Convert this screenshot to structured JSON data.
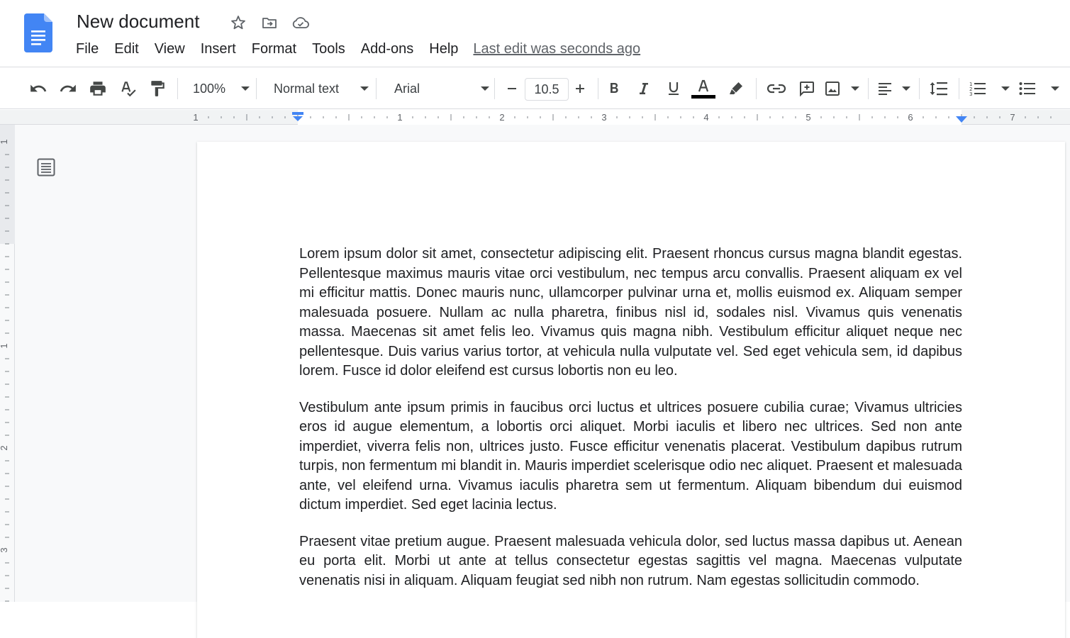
{
  "app": {
    "doc_title": "New document",
    "last_edit": "Last edit was seconds ago"
  },
  "menu": [
    "File",
    "Edit",
    "View",
    "Insert",
    "Format",
    "Tools",
    "Add-ons",
    "Help"
  ],
  "toolbar": {
    "zoom": "100%",
    "style": "Normal text",
    "font": "Arial",
    "font_size": "10.5"
  },
  "ruler": {
    "h_labels": [
      "1",
      "1",
      "2",
      "3",
      "4",
      "5",
      "6",
      "7"
    ],
    "v_labels": [
      "1",
      "1",
      "2",
      "3"
    ]
  },
  "document": {
    "paragraphs": [
      "Lorem ipsum dolor sit amet, consectetur adipiscing elit. Praesent rhoncus cursus magna blandit egestas. Pellentesque maximus mauris vitae orci vestibulum, nec tempus arcu convallis. Praesent aliquam ex vel mi efficitur mattis. Donec mauris nunc, ullamcorper pulvinar urna et, mollis euismod ex. Aliquam semper malesuada posuere. Nullam ac nulla pharetra, finibus nisl id, sodales nisl. Vivamus quis venenatis massa. Maecenas sit amet felis leo. Vivamus quis magna nibh. Vestibulum efficitur aliquet neque nec pellentesque. Duis varius varius tortor, at vehicula nulla vulputate vel. Sed eget vehicula sem, id dapibus lorem. Fusce id dolor eleifend est cursus lobortis non eu leo.",
      "Vestibulum ante ipsum primis in faucibus orci luctus et ultrices posuere cubilia curae; Vivamus ultricies eros id augue elementum, a lobortis orci aliquet. Morbi iaculis et libero nec ultrices. Sed non ante imperdiet, viverra felis non, ultrices justo. Fusce efficitur venenatis placerat. Vestibulum dapibus rutrum turpis, non fermentum mi blandit in. Mauris imperdiet scelerisque odio nec aliquet. Praesent et malesuada ante, vel eleifend urna. Vivamus iaculis pharetra sem ut fermentum. Aliquam bibendum dui euismod dictum imperdiet. Sed eget lacinia lectus.",
      "Praesent vitae pretium augue. Praesent malesuada vehicula dolor, sed luctus massa dapibus ut. Aenean eu porta elit. Morbi ut ante at tellus consectetur egestas sagittis vel magna. Maecenas vulputate venenatis nisi in aliquam. Aliquam feugiat sed nibh non rutrum. Nam egestas sollicitudin commodo."
    ]
  },
  "colors": {
    "docs_blue": "#4285f4",
    "text_color_underline": "#000000",
    "ruler_marker": "#4285f4"
  },
  "icons": {
    "logo": "google-docs-icon",
    "star": "star-icon",
    "move": "folder-move-icon",
    "cloud": "cloud-check-icon",
    "outline": "document-outline-icon"
  }
}
